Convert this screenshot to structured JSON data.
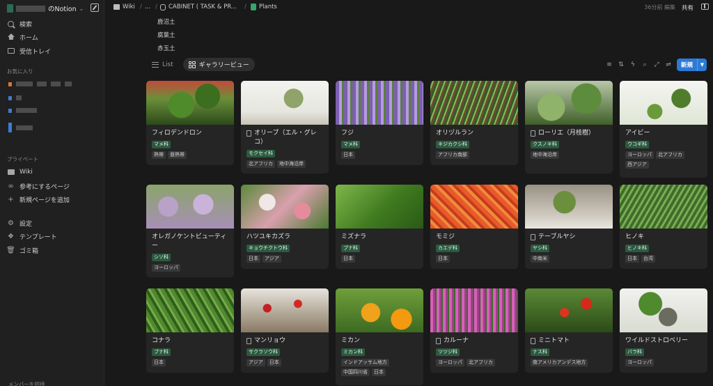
{
  "sidebar": {
    "workspace_name": "のNotion",
    "nav": [
      {
        "label": "検索",
        "icon": "search-icon"
      },
      {
        "label": "ホーム",
        "icon": "home-icon"
      },
      {
        "label": "受信トレイ",
        "icon": "inbox-icon"
      }
    ],
    "favorites_label": "お気に入り",
    "private_label": "プライベート",
    "private_items": [
      {
        "label": "Wiki",
        "icon": "wiki-icon"
      },
      {
        "label": "参考にするページ",
        "icon": "binoculars-icon"
      },
      {
        "label": "新規ページを追加",
        "icon": "plus-icon"
      }
    ],
    "bottom_items": [
      {
        "label": "設定",
        "icon": "gear-icon"
      },
      {
        "label": "テンプレート",
        "icon": "template-icon"
      },
      {
        "label": "ゴミ箱",
        "icon": "trash-icon"
      }
    ],
    "help_label": "メンバーを招待"
  },
  "topbar": {
    "breadcrumbs": [
      "Wiki",
      "...",
      "CABINET ( TASK & PR...",
      "Plants"
    ],
    "edited": "36分前 編集",
    "share": "共有"
  },
  "options_above": [
    "鹿沼土",
    "腐葉土",
    "赤玉土"
  ],
  "views": [
    {
      "label": "List",
      "active": false
    },
    {
      "label": "ギャラリービュー",
      "active": true
    }
  ],
  "new_button": "新規",
  "cards": [
    {
      "title": "フィロデンドロン",
      "has_doc": false,
      "family": "マメ科",
      "regions": [
        "熱帯",
        "亜熱帯"
      ]
    },
    {
      "title": "オリーブ（エル・グレコ）",
      "has_doc": true,
      "family": "モクセイ科",
      "regions": [
        "北アフリカ",
        "地中海沿岸"
      ]
    },
    {
      "title": "フジ",
      "has_doc": false,
      "family": "マメ科",
      "regions": [
        "日本"
      ]
    },
    {
      "title": "オリヅルラン",
      "has_doc": false,
      "family": "キジカクシ科",
      "regions": [
        "アフリカ南部"
      ]
    },
    {
      "title": "ローリエ（月桂樹）",
      "has_doc": true,
      "family": "クスノキ科",
      "regions": [
        "地中海沿岸"
      ]
    },
    {
      "title": "アイビー",
      "has_doc": false,
      "family": "ウコギ科",
      "regions": [
        "ヨーロッパ",
        "北アフリカ",
        "西アジア"
      ]
    },
    {
      "title": "オレガノケントビューティー",
      "has_doc": false,
      "family": "シソ科",
      "regions": [
        "ヨーロッパ"
      ]
    },
    {
      "title": "ハツユキカズラ",
      "has_doc": false,
      "family": "キョウチクトウ科",
      "regions": [
        "日本",
        "アジア"
      ]
    },
    {
      "title": "ミズナラ",
      "has_doc": false,
      "family": "ブナ科",
      "regions": [
        "日本"
      ]
    },
    {
      "title": "モミジ",
      "has_doc": false,
      "family": "カエデ科",
      "regions": [
        "日本"
      ]
    },
    {
      "title": "テーブルヤシ",
      "has_doc": true,
      "family": "ヤシ科",
      "regions": [
        "中南米"
      ]
    },
    {
      "title": "ヒノキ",
      "has_doc": false,
      "family": "ヒノキ科",
      "regions": [
        "日本",
        "台湾"
      ]
    },
    {
      "title": "コナラ",
      "has_doc": false,
      "family": "ブナ科",
      "regions": [
        "日本"
      ]
    },
    {
      "title": "マンリョウ",
      "has_doc": true,
      "family": "サクラソウ科",
      "regions": [
        "アジア",
        "日本"
      ]
    },
    {
      "title": "ミカン",
      "has_doc": false,
      "family": "ミカン科",
      "regions": [
        "インドアッサム地方",
        "中国四川省",
        "日本"
      ]
    },
    {
      "title": "カルーナ",
      "has_doc": true,
      "family": "ツツジ科",
      "regions": [
        "ヨーロッパ",
        "北アフリカ"
      ]
    },
    {
      "title": "ミニトマト",
      "has_doc": true,
      "family": "ナス科",
      "regions": [
        "南アメリカアンデス地方"
      ]
    },
    {
      "title": "ワイルドストロベリー",
      "has_doc": false,
      "family": "バラ科",
      "regions": [
        "ヨーロッパ"
      ]
    }
  ]
}
